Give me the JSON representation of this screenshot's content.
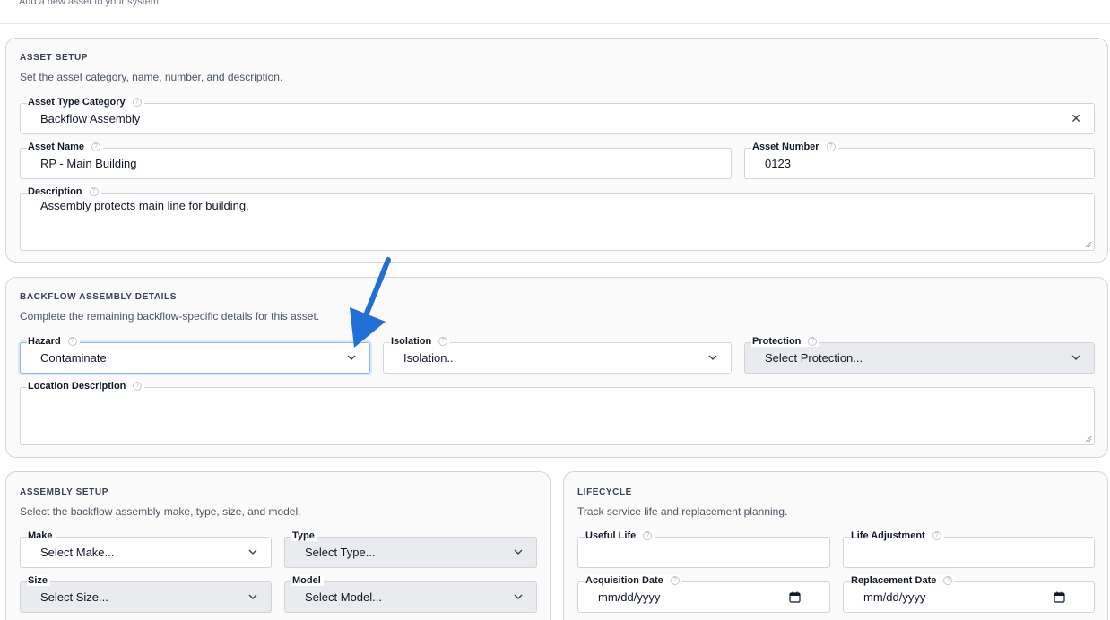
{
  "page": {
    "subtitle": "Add a new asset to your system"
  },
  "asset_setup": {
    "title": "ASSET SETUP",
    "description": "Set the asset category, name, number, and description.",
    "asset_type_category": {
      "label": "Asset Type Category",
      "value": "Backflow Assembly"
    },
    "asset_name": {
      "label": "Asset Name",
      "value": "RP - Main Building"
    },
    "asset_number": {
      "label": "Asset Number",
      "value": "0123"
    },
    "description_field": {
      "label": "Description",
      "value": "Assembly protects main line for building."
    }
  },
  "backflow_details": {
    "title": "BACKFLOW ASSEMBLY DETAILS",
    "description": "Complete the remaining backflow-specific details for this asset.",
    "hazard": {
      "label": "Hazard",
      "value": "Contaminate"
    },
    "isolation": {
      "label": "Isolation",
      "value": "Isolation..."
    },
    "protection": {
      "label": "Protection",
      "value": "Select Protection..."
    },
    "location_description": {
      "label": "Location Description",
      "value": ""
    }
  },
  "assembly_setup": {
    "title": "ASSEMBLY SETUP",
    "description": "Select the backflow assembly make, type, size, and model.",
    "make": {
      "label": "Make",
      "value": "Select Make..."
    },
    "type": {
      "label": "Type",
      "value": "Select Type..."
    },
    "size": {
      "label": "Size",
      "value": "Select Size..."
    },
    "model": {
      "label": "Model",
      "value": "Select Model..."
    }
  },
  "lifecycle": {
    "title": "LIFECYCLE",
    "description": "Track service life and replacement planning.",
    "useful_life": {
      "label": "Useful Life",
      "value": ""
    },
    "life_adjustment": {
      "label": "Life Adjustment",
      "value": ""
    },
    "acquisition_date": {
      "label": "Acquisition Date",
      "value": "mm/dd/yyyy"
    },
    "replacement_date": {
      "label": "Replacement Date",
      "value": "mm/dd/yyyy"
    }
  },
  "icons": {
    "help": "question-circle-icon",
    "dropdown": "chevron-down-icon",
    "clear": "close-icon",
    "calendar": "calendar-icon",
    "annotation": "arrow-pointer"
  },
  "colors": {
    "annotation_arrow": "#1f6fd6",
    "focus_border": "#93b4e8",
    "disabled_field": "#e9ebee"
  }
}
